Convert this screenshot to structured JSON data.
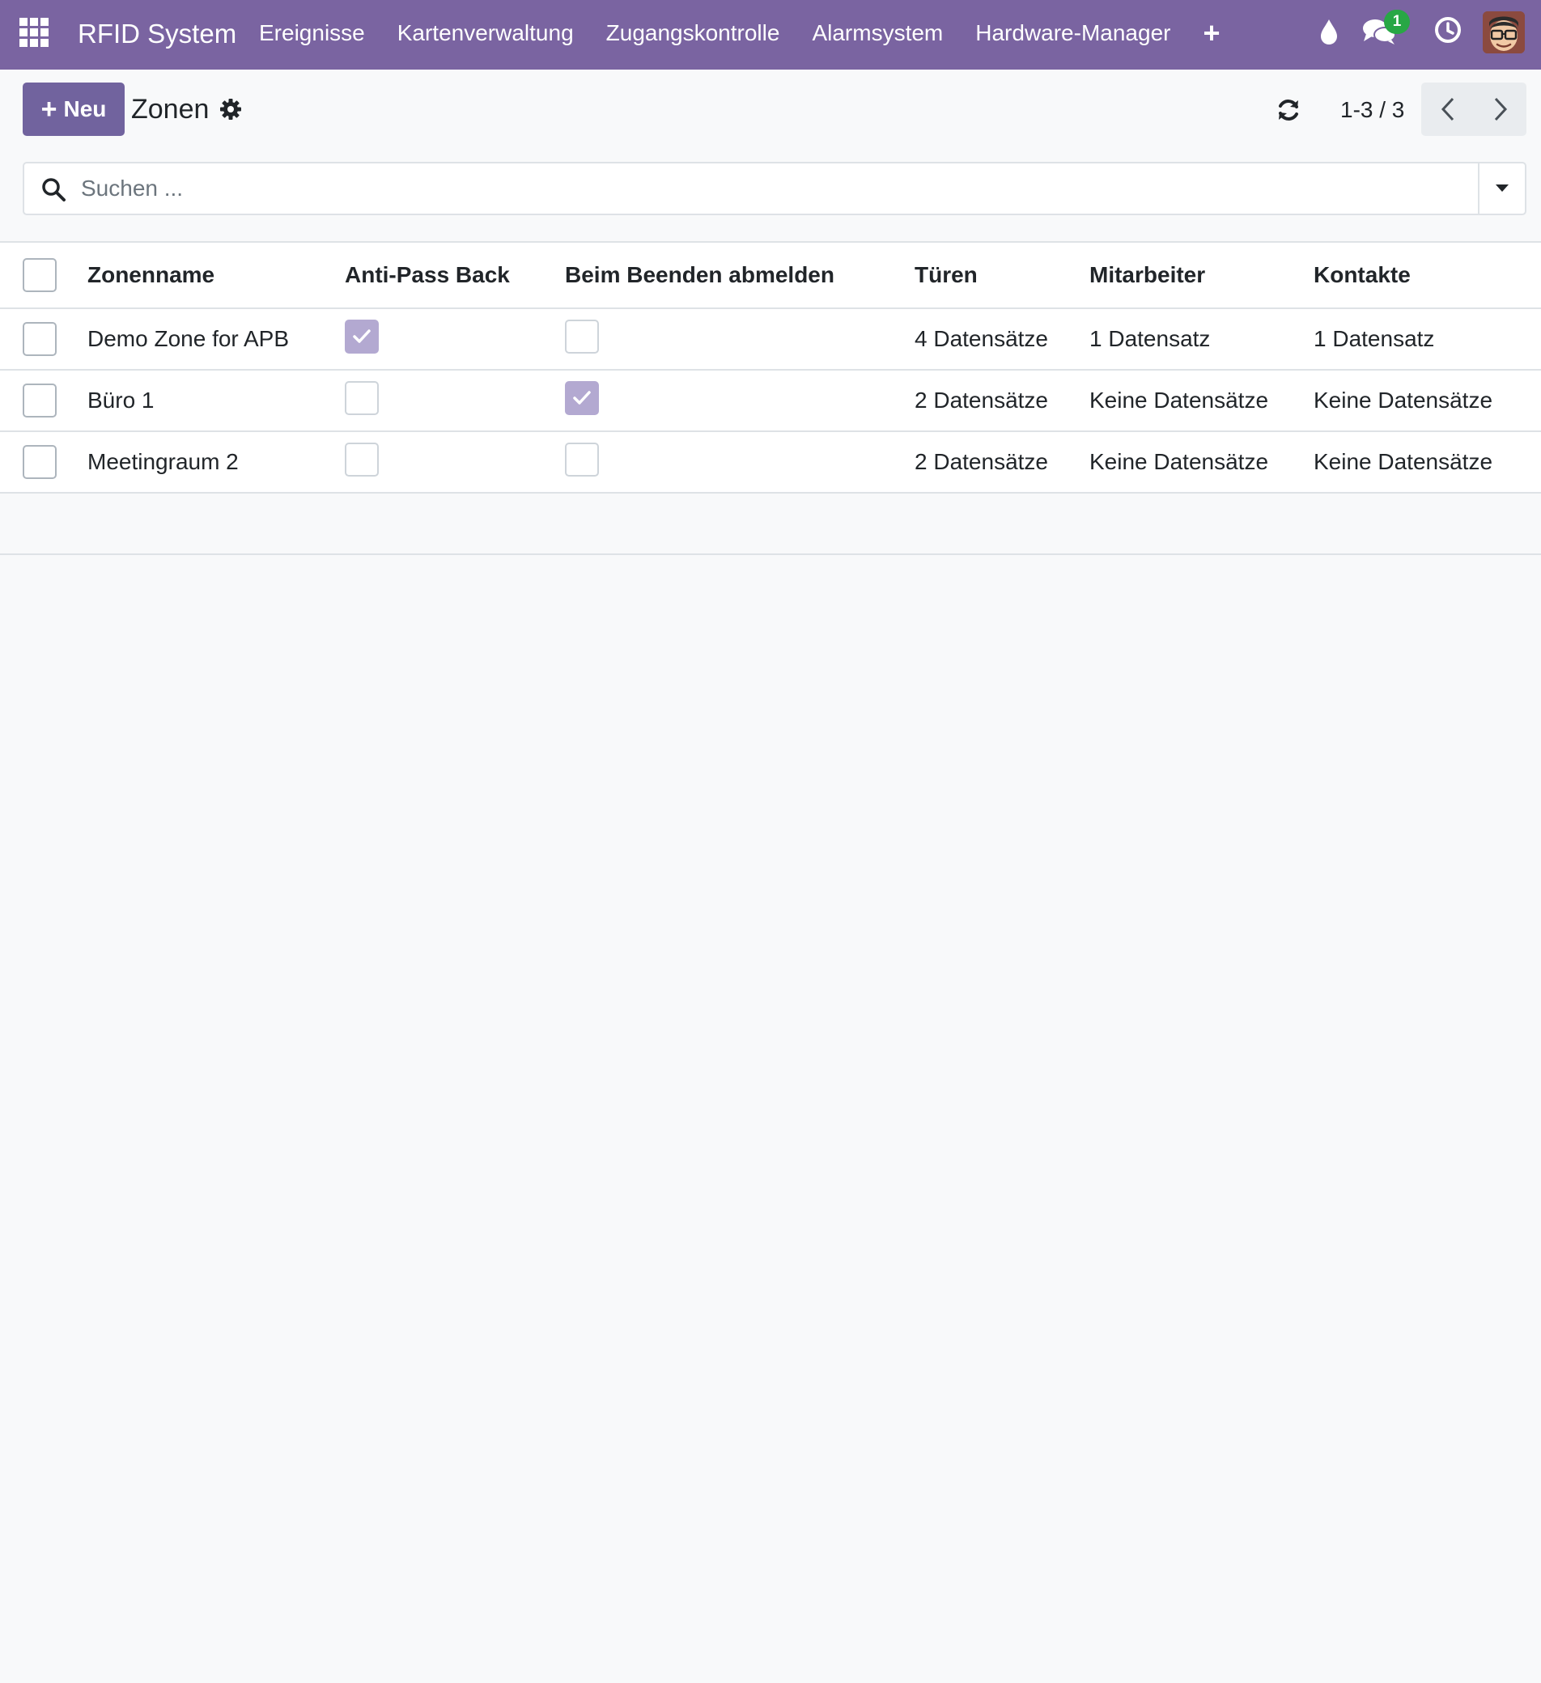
{
  "navbar": {
    "app_name": "RFID System",
    "menu": [
      "Ereignisse",
      "Kartenverwaltung",
      "Zugangskontrolle",
      "Alarmsystem",
      "Hardware-Manager"
    ],
    "add_menu_symbol": "+",
    "chat_badge_count": "1",
    "icons": [
      "apps-grid-icon",
      "drop-icon",
      "chat-icon",
      "clock-icon",
      "user-avatar"
    ]
  },
  "control_panel": {
    "new_button_label": "Neu",
    "title": "Zonen",
    "pager_value": "1-3 / 3"
  },
  "search": {
    "placeholder": "Suchen ..."
  },
  "table": {
    "columns": [
      "Zonenname",
      "Anti-Pass Back",
      "Beim Beenden abmelden",
      "Türen",
      "Mitarbeiter",
      "Kontakte"
    ],
    "rows": [
      {
        "name": "Demo Zone for APB",
        "anti_pass_back": true,
        "logout_on_exit": false,
        "doors": "4 Datensätze",
        "employees": "1 Datensatz",
        "contacts": "1 Datensatz"
      },
      {
        "name": "Büro 1",
        "anti_pass_back": false,
        "logout_on_exit": true,
        "doors": "2 Datensätze",
        "employees": "Keine Datensätze",
        "contacts": "Keine Datensätze"
      },
      {
        "name": "Meetingraum 2",
        "anti_pass_back": false,
        "logout_on_exit": false,
        "doors": "2 Datensätze",
        "employees": "Keine Datensätze",
        "contacts": "Keine Datensätze"
      }
    ]
  },
  "colors": {
    "navbar": "#7a64a1",
    "primary_button": "#71639e",
    "checked_boolean": "#b3a9d1",
    "badge": "#28a745",
    "background": "#f8f9fa"
  }
}
